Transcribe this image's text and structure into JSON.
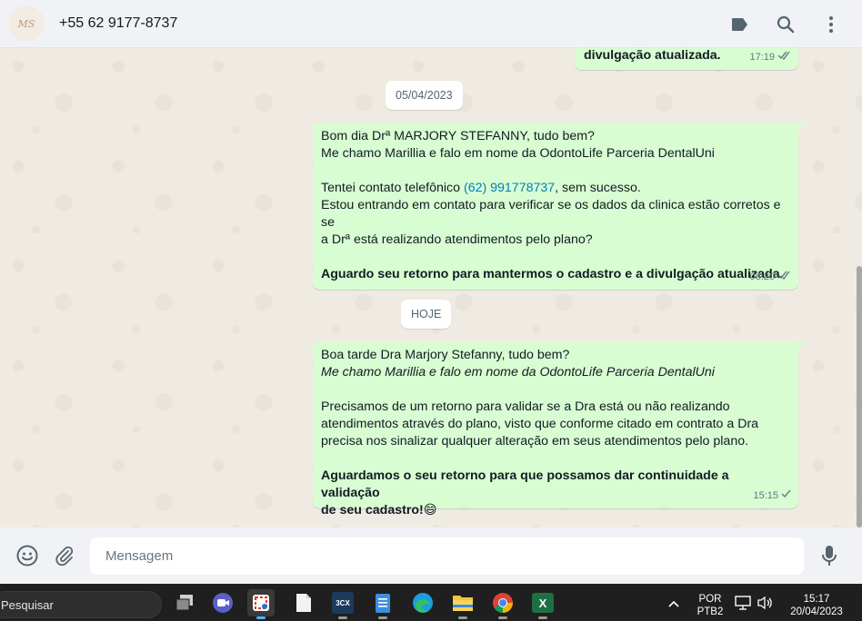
{
  "header": {
    "contact_name": "+55 62 9177-8737",
    "avatar_initials": "MS",
    "icons": [
      "label-icon",
      "search-icon",
      "menu-icon"
    ]
  },
  "chat": {
    "top_message": {
      "text": "divulgação atualizada.",
      "time": "17:19"
    },
    "date_separator_1": "05/04/2023",
    "message_1": {
      "line1": "Bom dia Drª MARJORY STEFANNY, tudo bem?",
      "line2": "Me chamo Marillia e falo em nome da OdontoLife Parceria DentalUni",
      "line3_prefix": "Tentei contato telefônico ",
      "line3_link": "(62) 991778737",
      "line3_suffix": ", sem sucesso.",
      "line4": "Estou entrando em contato para verificar se os dados da clinica estão corretos e se",
      "line5": "a Drª está realizando atendimentos pelo plano?",
      "line6": "Aguardo seu retorno para mantermos o cadastro e a divulgação atualizada.",
      "time": "08:20"
    },
    "date_separator_2": "HOJE",
    "message_2": {
      "line1": "Boa tarde Dra Marjory Stefanny, tudo bem?",
      "line2": "Me chamo Marillia e falo em nome da OdontoLife Parceria DentalUni",
      "line3": "Precisamos de um retorno para validar se a Dra está ou não realizando",
      "line4": "atendimentos através do plano, visto que conforme citado em contrato a Dra",
      "line5": "precisa nos sinalizar qualquer alteração em seus atendimentos pelo plano.",
      "line6": "Aguardamos o seu retorno para que possamos dar continuidade a validação",
      "line7": "de seu cadastro!",
      "emoji": "😄",
      "time": "15:15"
    }
  },
  "footer": {
    "placeholder": "Mensagem",
    "icons": [
      "emoji-icon",
      "attach-icon",
      "microphone-icon"
    ]
  },
  "taskbar": {
    "search_label": "Pesquisar",
    "apps": [
      "task-view-icon",
      "video-chat-icon",
      "snipping-tool-icon",
      "file-icon",
      "3cx-icon",
      "notepad-icon",
      "edge-icon",
      "file-explorer-icon",
      "chrome-icon",
      "excel-icon"
    ],
    "app_3cx_label": "3CX",
    "excel_label": "X",
    "lang_line1": "POR",
    "lang_line2": "PTB2",
    "time": "15:17",
    "date": "20/04/2023"
  }
}
